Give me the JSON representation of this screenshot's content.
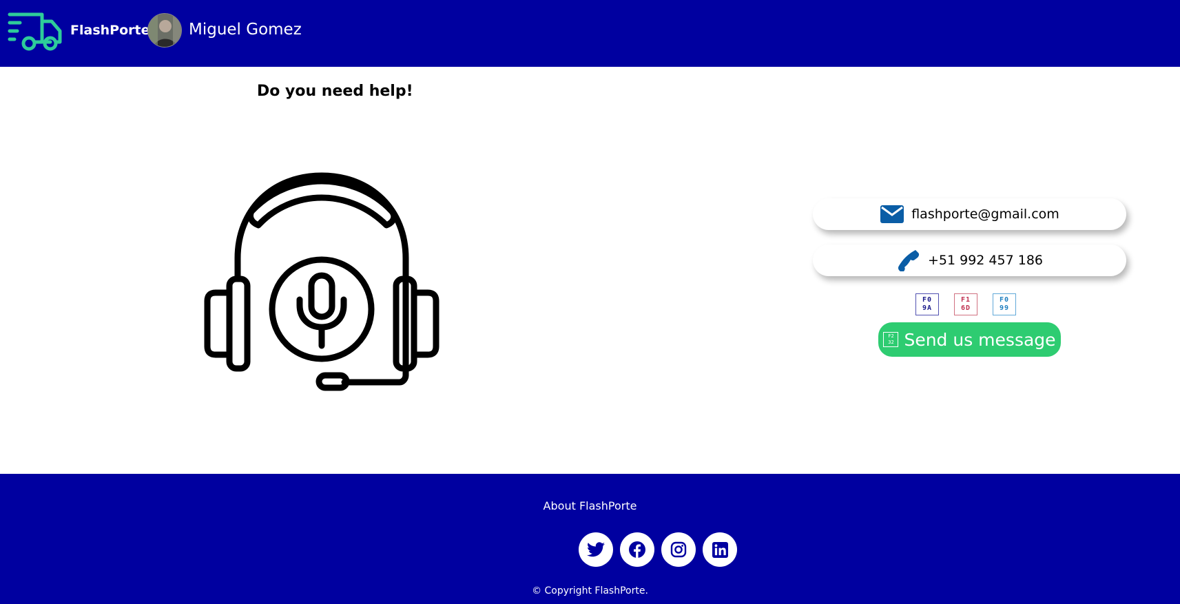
{
  "navbar": {
    "brand": "FlashPorte",
    "username": "Miguel Gomez",
    "truck_color": "#2ecc9a",
    "background": "#0000a0"
  },
  "main": {
    "title": "Do you need help!",
    "illustration": "headset-microphone-icon",
    "contact": {
      "email": "flashporte@gmail.com",
      "email_icon": "envelope-icon",
      "phone": "+51 992 457 186",
      "phone_icon": "phone-icon",
      "icon_color": "#0a5da6"
    },
    "glyphs": [
      {
        "top": "F0",
        "bottom": "9A",
        "color": "#1a1a8a"
      },
      {
        "top": "F1",
        "bottom": "6D",
        "color": "#c03050"
      },
      {
        "top": "F0",
        "bottom": "99",
        "color": "#2080c0"
      }
    ],
    "send_button": {
      "label": "Send us message",
      "glyph_top": "F2",
      "glyph_bottom": "32",
      "color": "#2ecc71"
    }
  },
  "footer": {
    "about": "About FlashPorte",
    "socials": [
      "twitter-icon",
      "facebook-icon",
      "instagram-icon",
      "linkedin-icon"
    ],
    "copyright": "© Copyright FlashPorte."
  }
}
